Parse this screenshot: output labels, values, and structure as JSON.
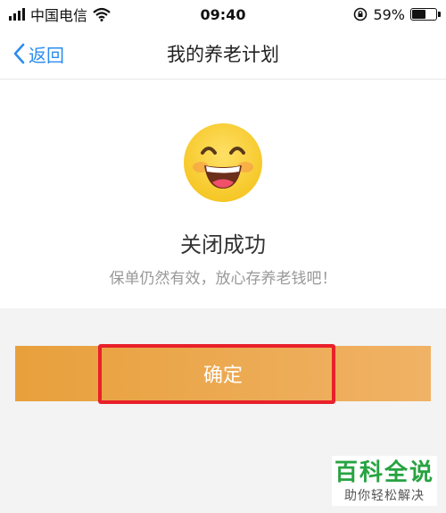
{
  "status_bar": {
    "carrier": "中国电信",
    "time": "09:40",
    "battery_percent": "59%",
    "battery_level": 0.59
  },
  "nav": {
    "back_label": "返回",
    "title": "我的养老计划"
  },
  "result": {
    "icon": "grinning-face-emoji",
    "headline": "关闭成功",
    "message": "保单仍然有效，放心存养老钱吧！"
  },
  "actions": {
    "confirm_label": "确定"
  },
  "watermark": {
    "title": "百科全说",
    "subtitle": "助你轻松解决"
  },
  "colors": {
    "accent_blue": "#2b8cf0",
    "button_orange": "#e8a03c",
    "highlight_red": "#e8202a",
    "watermark_green": "#27a341"
  }
}
